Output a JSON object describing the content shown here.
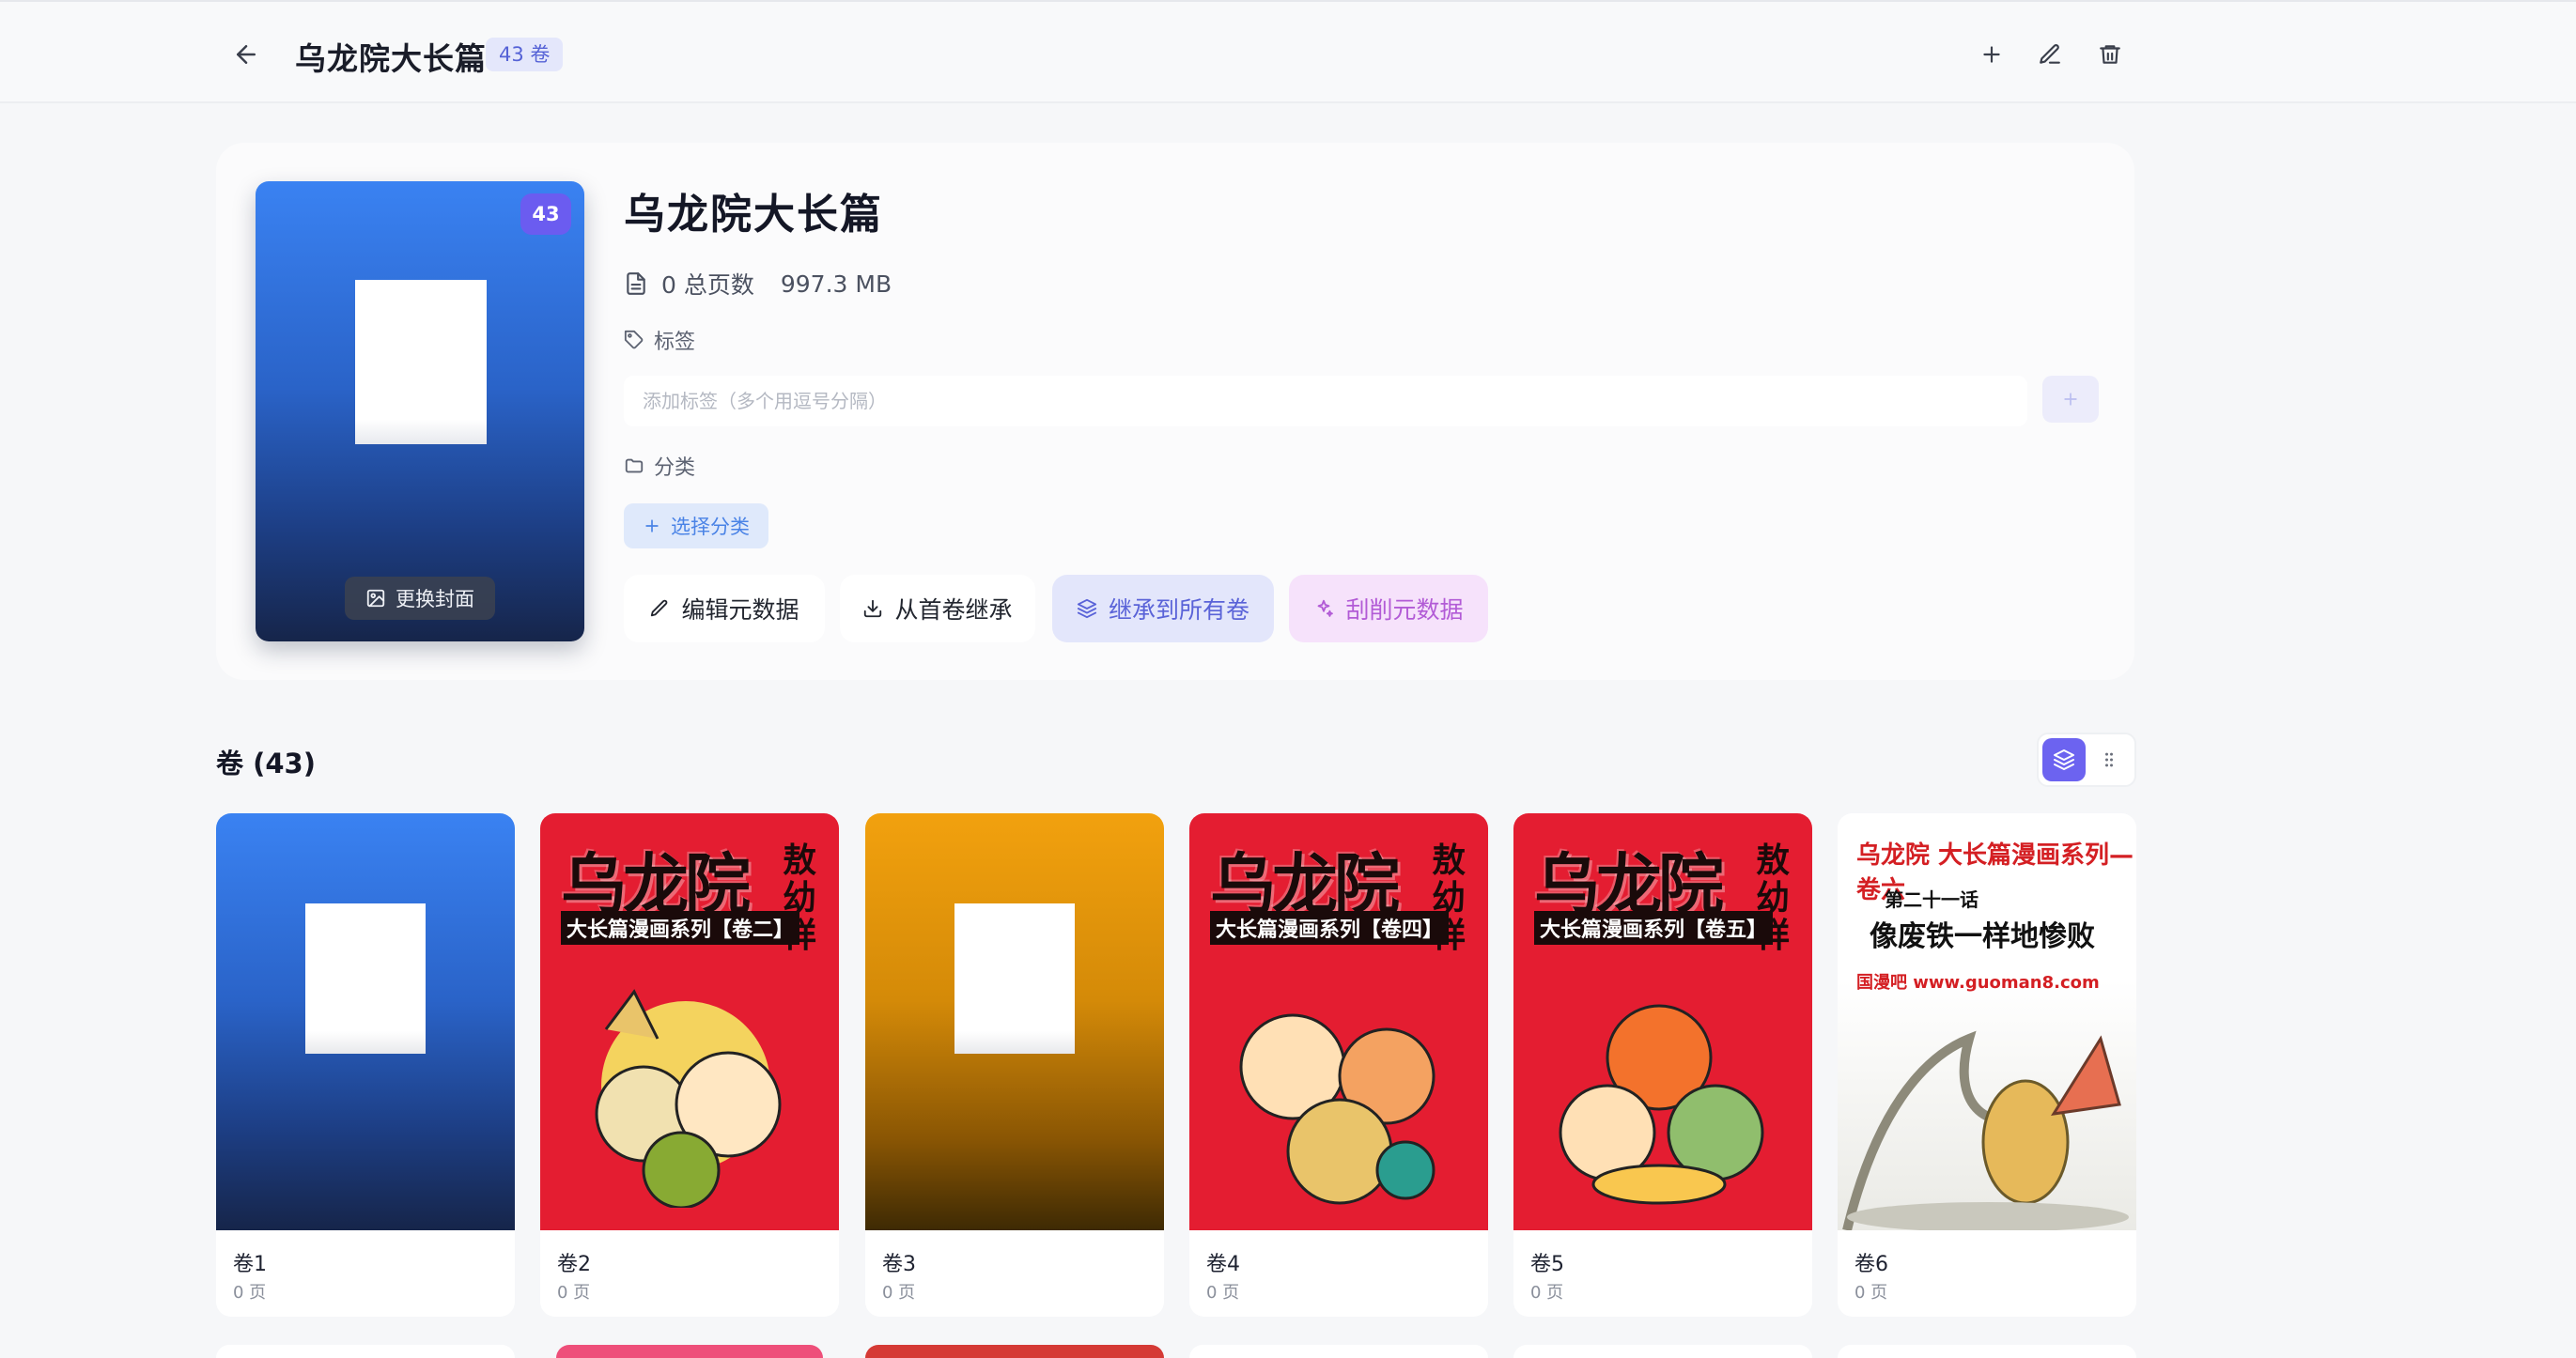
{
  "header": {
    "title": "乌龙院大长篇",
    "badge": "43 卷",
    "actions": [
      "plus-icon",
      "edit-icon",
      "trash-icon"
    ]
  },
  "info": {
    "title": "乌龙院大长篇",
    "cover_count": "43",
    "change_cover_label": "更换封面",
    "total_pages": "0 总页数",
    "size": "997.3 MB",
    "tags_label": "标签",
    "tag_placeholder": "添加标签（多个用逗号分隔）",
    "category_label": "分类",
    "choose_category": "选择分类",
    "buttons": {
      "edit_meta": "编辑元数据",
      "inherit_first": "从首卷继承",
      "inherit_all": "继承到所有卷",
      "scrape": "刮削元数据"
    }
  },
  "volumes": {
    "heading": "卷 (43)",
    "view_modes": [
      "stack-view",
      "grid-view"
    ],
    "active_view": "stack-view",
    "items": [
      {
        "name": "卷1",
        "pages": "0 页"
      },
      {
        "name": "卷2",
        "pages": "0 页"
      },
      {
        "name": "卷3",
        "pages": "0 页"
      },
      {
        "name": "卷4",
        "pages": "0 页"
      },
      {
        "name": "卷5",
        "pages": "0 页"
      },
      {
        "name": "卷6",
        "pages": "0 页"
      }
    ],
    "cover_text": {
      "v2_title": "乌龙院",
      "v2_side": "敖幼祥",
      "v2_sub": "大长篇漫画系列【卷二】",
      "v4_sub": "大长篇漫画系列【卷四】",
      "v5_sub": "大长篇漫画系列【卷五】",
      "v6_line1": "乌龙院 大长篇漫画系列— 卷六",
      "v6_line2": "第二十一话",
      "v6_line3": "像废铁一样地惨败",
      "v6_url": "国漫吧 www.guoman8.com"
    }
  },
  "colors": {
    "accent": "#6c63f0",
    "brand_blue": "#4a83e6",
    "badge_bg": "#e4e7fb"
  }
}
